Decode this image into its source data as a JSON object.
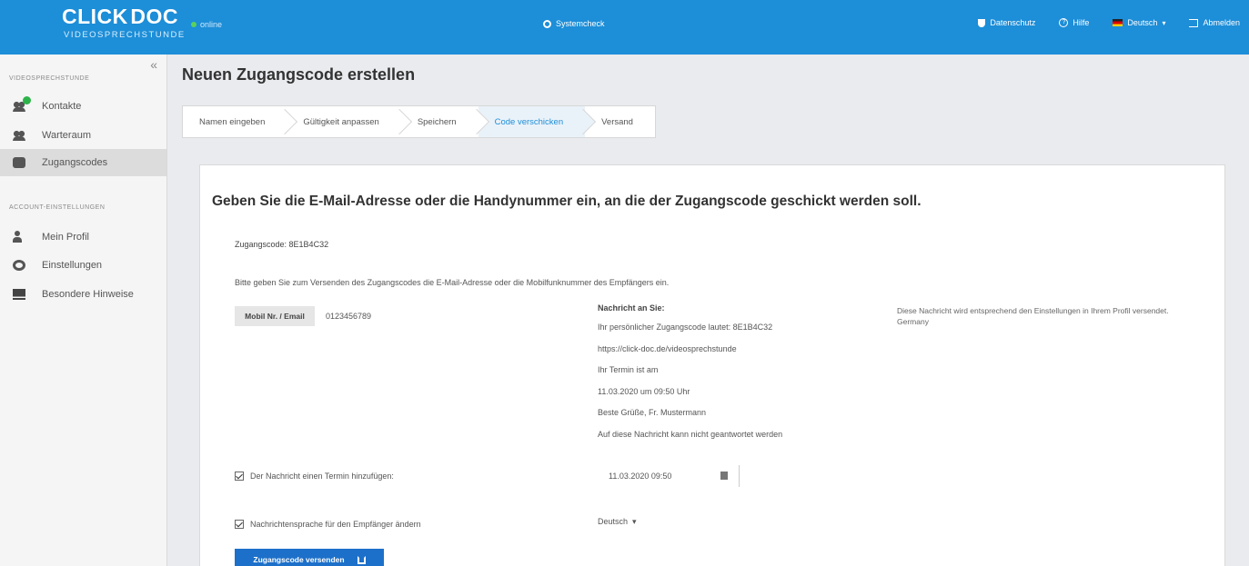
{
  "header": {
    "logo_main_left": "CLICK",
    "logo_main_right": "DOC",
    "logo_sub": "VIDEOSPRECHSTUNDE",
    "online_status": "online",
    "system_check": "Systemcheck",
    "nav": {
      "privacy": "Datenschutz",
      "help": "Hilfe",
      "language": "Deutsch",
      "logout": "Abmelden"
    },
    "colors": {
      "bar": "#1d8ed8",
      "online_dot": "#5bd15b"
    }
  },
  "sidebar": {
    "section_main": "Videosprechstunde",
    "items_main": [
      {
        "label": "Kontakte",
        "icon": "contacts-icon"
      },
      {
        "label": "Warteraum",
        "icon": "waiting-room-icon"
      },
      {
        "label": "Zugangscodes",
        "icon": "key-icon"
      }
    ],
    "section_account": "Account-Einstellungen",
    "items_account": [
      {
        "label": "Mein Profil",
        "icon": "user-icon"
      },
      {
        "label": "Einstellungen",
        "icon": "gear-icon"
      },
      {
        "label": "Besondere Hinweise",
        "icon": "exclamation-icon"
      }
    ]
  },
  "page": {
    "title": "Neuen Zugangscode erstellen",
    "steps": [
      "Namen eingeben",
      "Gültigkeit anpassen",
      "Speichern",
      "Code verschicken",
      "Versand"
    ],
    "current_step": "Code verschicken"
  },
  "form": {
    "heading": "Geben Sie die E-Mail-Adresse oder die Handynummer ein, an die der Zugangscode geschickt werden soll.",
    "code_line": "Zugangscode: 8E1B4C32",
    "hint": "Bitte geben Sie zum Versenden des Zugangscodes die E-Mail-Adresse oder die Mobilfunknummer des Empfängers ein.",
    "contact_label": "Mobil Nr. / Email",
    "contact_value": "0123456789",
    "preview_title": "Nachricht an Sie:",
    "preview_lines": [
      "Ihr persönlicher Zugangscode lautet: 8E1B4C32",
      "https://click-doc.de/videosprechstunde",
      "Ihr Termin ist am",
      "11.03.2020 um 09:50 Uhr",
      "Beste Grüße, Fr. Mustermann",
      "Auf diese Nachricht kann nicht geantwortet werden"
    ],
    "note": "Diese Nachricht wird entsprechend den Einstellungen in Ihrem Profil versendet. Germany",
    "check_date_label": "Der Nachricht einen Termin hinzufügen:",
    "check_date_checked": true,
    "date_value": "11.03.2020 09:50",
    "check_lang_label": "Nachrichtensprache für den Empfänger ändern",
    "check_lang_checked": true,
    "language_value": "Deutsch",
    "send_button": "Zugangscode versenden"
  }
}
